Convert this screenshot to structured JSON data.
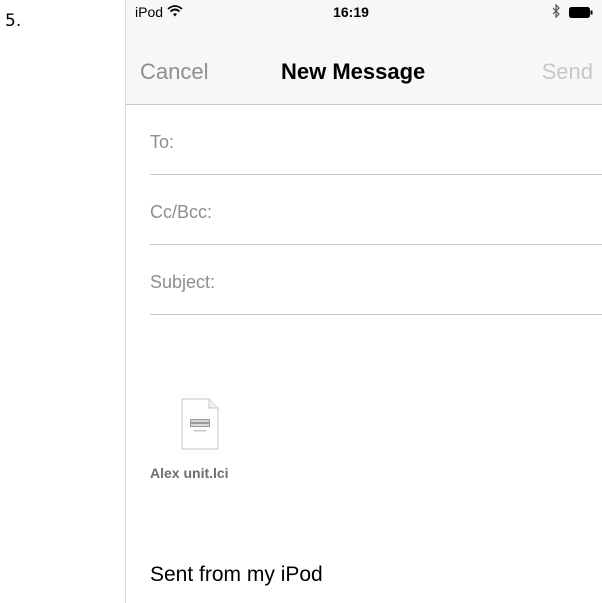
{
  "step": {
    "number": "5."
  },
  "status_bar": {
    "carrier": "iPod",
    "time": "16:19",
    "icons": [
      "wifi-icon",
      "bluetooth-icon",
      "battery-icon"
    ]
  },
  "nav": {
    "cancel_label": "Cancel",
    "title": "New Message",
    "send_label": "Send"
  },
  "fields": {
    "to_label": "To:",
    "ccbcc_label": "Cc/Bcc:",
    "subject_label": "Subject:"
  },
  "attachment": {
    "filename": "Alex unit.lci",
    "icon": "document-icon"
  },
  "body": {
    "signature": "Sent from my iPod"
  },
  "colors": {
    "bar_background": "#f7f7f7",
    "disabled_text": "#c7c7cc",
    "secondary_text": "#8e8e93",
    "separator": "#c8c7cc"
  }
}
